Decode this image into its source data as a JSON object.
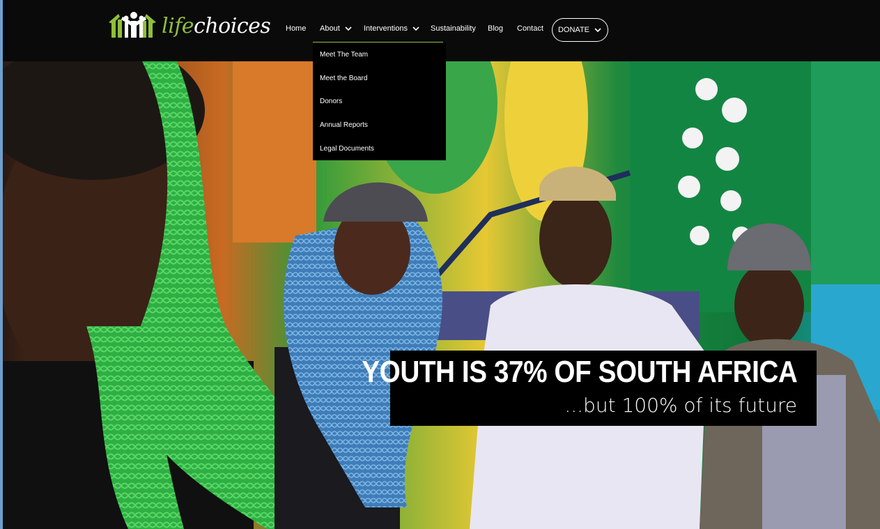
{
  "brand": {
    "logo_word1": "life",
    "logo_word2": "choices",
    "logo_icon": "family-figures-icon",
    "accent_color": "#8fbf3c"
  },
  "nav": {
    "home": "Home",
    "about": "About",
    "interventions": "Interventions",
    "sustainability": "Sustainability",
    "blog": "Blog",
    "contact": "Contact",
    "donate": "DONATE"
  },
  "about_menu": {
    "items": [
      {
        "label": "Meet The Team"
      },
      {
        "label": "Meet the Board"
      },
      {
        "label": "Donors"
      },
      {
        "label": "Annual Reports"
      },
      {
        "label": "Legal Documents"
      }
    ]
  },
  "hero": {
    "headline": "YOUTH IS 37% OF SOUTH AFRICA",
    "subheadline": "...but 100% of its future",
    "image": "photo of four young people in front of a colorful mural"
  }
}
